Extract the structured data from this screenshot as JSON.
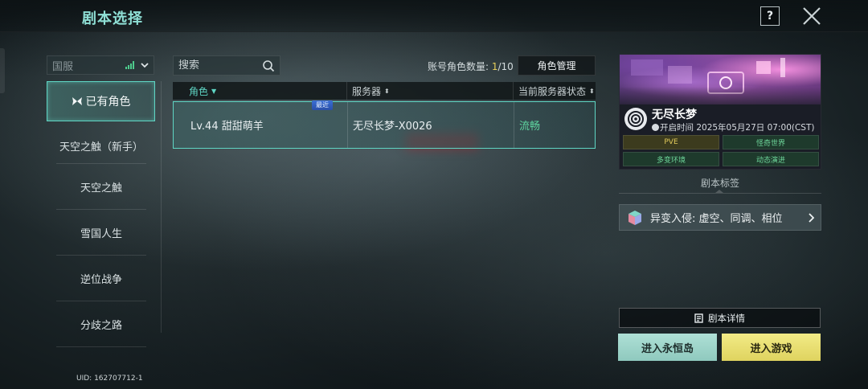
{
  "header": {
    "title": "剧本选择",
    "help_label": "?",
    "close_icon": "close-icon"
  },
  "sidebar": {
    "region_label": "国服",
    "owned_label": "已有角色",
    "items": [
      {
        "label": "天空之触（新手）"
      },
      {
        "label": "天空之触"
      },
      {
        "label": "雪国人生"
      },
      {
        "label": "逆位战争"
      },
      {
        "label": "分歧之路"
      }
    ],
    "uid": "UID: 162707712-1"
  },
  "search": {
    "placeholder": "搜索"
  },
  "account": {
    "count_label": "账号角色数量: ",
    "count_current": "1",
    "count_total": "/10",
    "manage_label": "角色管理"
  },
  "table": {
    "columns": [
      "角色",
      "服务器",
      "当前服务器状态"
    ],
    "rows": [
      {
        "character": "Lv.44 甜甜萌羊",
        "server": "无尽长梦-X0026",
        "status": "流畅",
        "badge": "最近"
      }
    ]
  },
  "card": {
    "name": "无尽长梦",
    "time": "开启时间 2025年05月27日 07:00(CST)",
    "tags": [
      "PVE",
      "怪奇世界",
      "多变环境",
      "动态演进"
    ]
  },
  "tags_section": {
    "title": "剧本标签",
    "mutation_label": "异变入侵: 虚空、同调、相位"
  },
  "actions": {
    "detail_label": "剧本详情",
    "island_label": "进入永恒岛",
    "enter_label": "进入游戏"
  },
  "colors": {
    "accent": "#5fd6c4",
    "status_good": "#5fd6a0",
    "count_highlight": "#e6cf5a",
    "enter_button": "#e8df6e",
    "island_button": "#9fd6cb"
  }
}
